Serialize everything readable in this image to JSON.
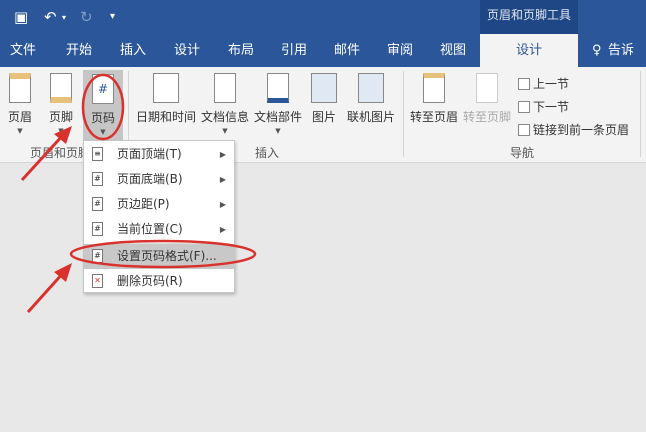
{
  "qat": {
    "save": "save-icon",
    "undo": "↶",
    "redo": "↻",
    "customize": "⩡"
  },
  "contextual_tab": "页眉和页脚工具",
  "tabs": [
    "文件",
    "开始",
    "插入",
    "设计",
    "布局",
    "引用",
    "邮件",
    "审阅",
    "视图",
    "设计"
  ],
  "tell_me": "告诉我",
  "ribbon": {
    "group1": {
      "label": "页眉和页脚",
      "buttons": [
        "页眉",
        "页脚",
        "页码"
      ]
    },
    "group2": {
      "label": "插入",
      "buttons": [
        "日期和时间",
        "文档信息",
        "文档部件",
        "图片",
        "联机图片"
      ]
    },
    "group3": {
      "label": "导航",
      "buttons": [
        "转至页眉",
        "转至页脚"
      ],
      "small": [
        "上一节",
        "下一节",
        "链接到前一条页眉"
      ]
    }
  },
  "menu": [
    {
      "label": "页面顶端(T)",
      "submenu": true
    },
    {
      "label": "页面底端(B)",
      "submenu": true
    },
    {
      "label": "页边距(P)",
      "submenu": true
    },
    {
      "label": "当前位置(C)",
      "submenu": true
    },
    {
      "label": "设置页码格式(F)...",
      "submenu": false,
      "highlighted": true
    },
    {
      "label": "删除页码(R)",
      "submenu": false
    }
  ],
  "colors": {
    "brand": "#2b579a",
    "annotation": "#d9322e"
  }
}
